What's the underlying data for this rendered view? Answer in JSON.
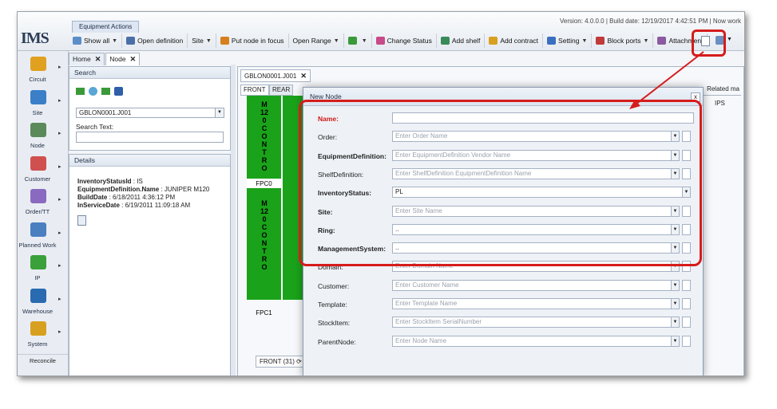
{
  "app": {
    "logo": "IMS",
    "version_info": "Version: 4.0.0.0  |  Build date: 12/19/2017 4:42:51 PM  |  Now work"
  },
  "ribbon": {
    "tab_label": "Equipment Actions",
    "items": [
      {
        "label": "Show all",
        "icon": "show-all-icon",
        "dropdown": true
      },
      {
        "label": "Open definition",
        "icon": "open-definition-icon",
        "dropdown": false
      },
      {
        "label": "Site",
        "icon": "",
        "dropdown": true
      },
      {
        "label": "Put node in focus",
        "icon": "focus-icon",
        "dropdown": false
      },
      {
        "label": "Open Range",
        "icon": "",
        "dropdown": true
      },
      {
        "label": "",
        "icon": "cable-icon",
        "dropdown": true
      },
      {
        "label": "Change Status",
        "icon": "change-status-icon",
        "dropdown": false
      },
      {
        "label": "Add shelf",
        "icon": "add-shelf-icon",
        "dropdown": false
      },
      {
        "label": "Add contract",
        "icon": "add-contract-icon",
        "dropdown": false
      },
      {
        "label": "Setting",
        "icon": "setting-icon",
        "dropdown": true
      },
      {
        "label": "Block ports",
        "icon": "block-ports-icon",
        "dropdown": true
      },
      {
        "label": "Attachment",
        "icon": "attachment-icon",
        "dropdown": false
      }
    ]
  },
  "leftnav": {
    "items": [
      {
        "label": "Circuit",
        "icon": "circuit-icon"
      },
      {
        "label": "Site",
        "icon": "site-icon"
      },
      {
        "label": "Node",
        "icon": "node-icon"
      },
      {
        "label": "Customer",
        "icon": "customer-icon"
      },
      {
        "label": "Order/TT",
        "icon": "order-icon"
      },
      {
        "label": "Planned Work",
        "icon": "planned-work-icon"
      },
      {
        "label": "IP",
        "icon": "ip-icon"
      },
      {
        "label": "Warehouse",
        "icon": "warehouse-icon"
      },
      {
        "label": "System",
        "icon": "system-icon"
      }
    ],
    "reconcile": "Reconcile"
  },
  "pagetabs": [
    {
      "label": "Home"
    },
    {
      "label": "Node"
    }
  ],
  "search": {
    "title": "Search",
    "selected": "GBLON0001.J001",
    "text_label": "Search Text:",
    "text_value": ""
  },
  "details": {
    "title": "Details",
    "lines": [
      {
        "key": "InventoryStatusId",
        "value": " : IS"
      },
      {
        "key": "EquipmentDefinition.Name",
        "value": " : JUNIPER M120"
      },
      {
        "key": "BuildDate",
        "value": " : 6/18/2011 4:36:12 PM"
      },
      {
        "key": "InServiceDate",
        "value": " : 6/19/2011 11:09:18 AM"
      }
    ]
  },
  "node_view": {
    "tab": "GBLON0001.J001",
    "subtabs": [
      "FRONT",
      "REAR"
    ],
    "rack_text": "M120CONTRO",
    "fpc0": "FPC0",
    "fpc1": "FPC1",
    "bottom_tab": "FRONT (31)",
    "right_partial": "Related ma",
    "right_partial2": "IPS"
  },
  "modal": {
    "title": "New Node",
    "fields": [
      {
        "label": "Name:",
        "value": "",
        "placeholder": "",
        "style": "red",
        "type": "text"
      },
      {
        "label": "Order:",
        "value": "",
        "placeholder": "Enter Order Name",
        "style": "normal",
        "type": "lookup"
      },
      {
        "label": "EquipmentDefinition:",
        "value": "",
        "placeholder": "Enter EquipmentDefinition Vendor Name",
        "style": "bold",
        "type": "lookup"
      },
      {
        "label": "ShelfDefinition:",
        "value": "",
        "placeholder": "Enter ShelfDefinition EquipmentDefinition Name",
        "style": "normal",
        "type": "lookup"
      },
      {
        "label": "InventoryStatus:",
        "value": "PL",
        "placeholder": "",
        "style": "bold",
        "type": "select"
      },
      {
        "label": "Site:",
        "value": "",
        "placeholder": "Enter Site Name",
        "style": "bold",
        "type": "lookup"
      },
      {
        "label": "Ring:",
        "value": "..",
        "placeholder": "",
        "style": "bold",
        "type": "lookup"
      },
      {
        "label": "ManagementSystem:",
        "value": "..",
        "placeholder": "",
        "style": "bold",
        "type": "lookup"
      },
      {
        "label": "Domain:",
        "value": "",
        "placeholder": "Enter Domain Name",
        "style": "normal",
        "type": "lookup"
      },
      {
        "label": "Customer:",
        "value": "",
        "placeholder": "Enter Customer Name",
        "style": "normal",
        "type": "lookup"
      },
      {
        "label": "Template:",
        "value": "",
        "placeholder": "Enter Template Name",
        "style": "normal",
        "type": "lookup"
      },
      {
        "label": "StockItem:",
        "value": "",
        "placeholder": "Enter StockItem SerialNumber",
        "style": "normal",
        "type": "lookup"
      },
      {
        "label": "ParentNode:",
        "value": "",
        "placeholder": "Enter Node Name",
        "style": "normal",
        "type": "lookup"
      }
    ]
  },
  "colors": {
    "highlight": "#d61c1c",
    "rack_green": "#1aa31a",
    "required_label": "#d01818"
  }
}
